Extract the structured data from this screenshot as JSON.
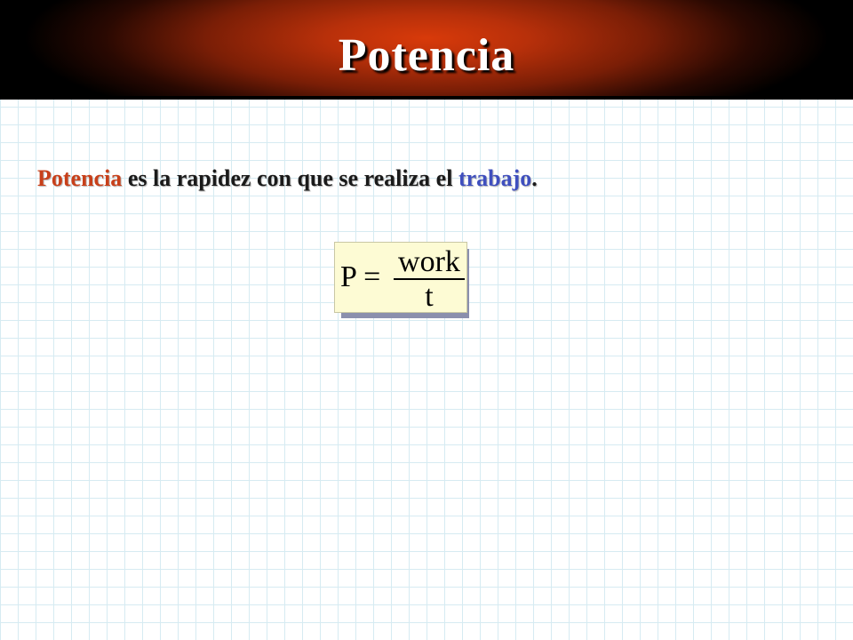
{
  "slide": {
    "title": "Potencia",
    "sentence": {
      "term": "Potencia",
      "middle": " es la rapidez con que se realiza el ",
      "keyword": "trabajo",
      "end": "."
    },
    "formula": {
      "lhs": "P =",
      "numerator": "work",
      "denominator": "t"
    }
  },
  "colors": {
    "title_glow": "#d83a0a",
    "term": "#c8401a",
    "keyword": "#3f4fbe",
    "formula_background": "#fdfbd4"
  }
}
